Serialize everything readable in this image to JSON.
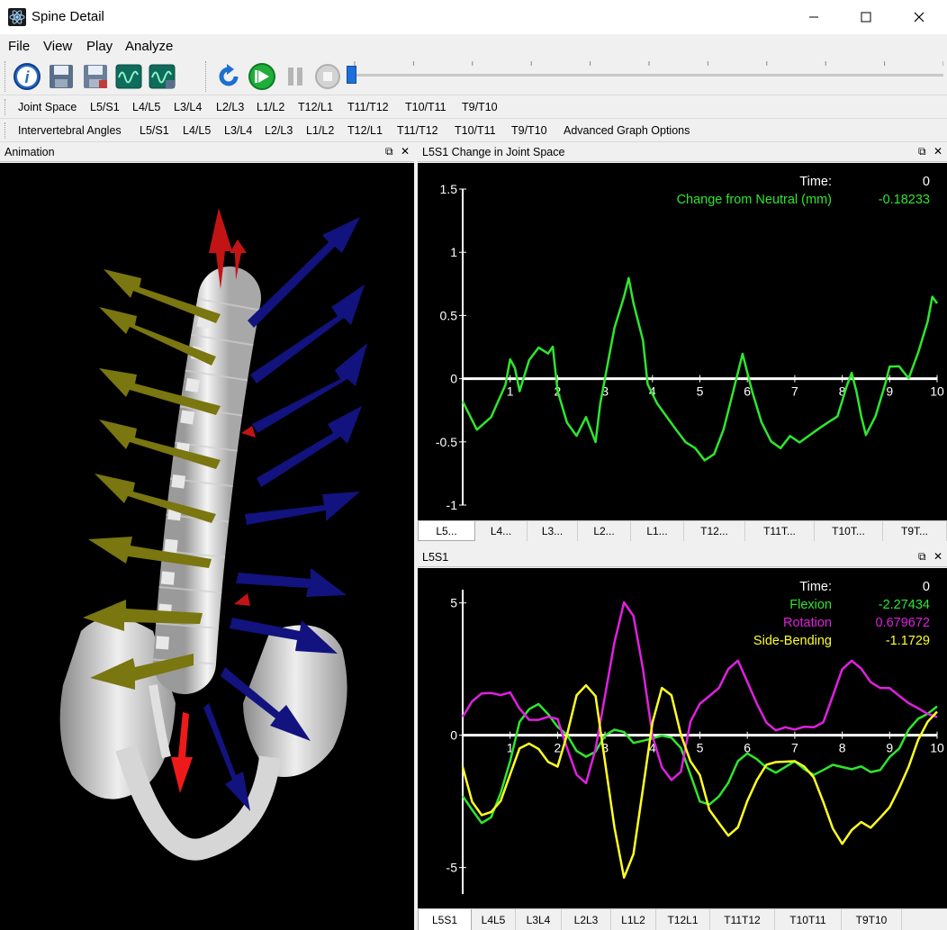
{
  "window": {
    "title": "Spine Detail"
  },
  "menu": [
    "File",
    "View",
    "Play",
    "Analyze"
  ],
  "toolbar": {
    "buttons": [
      "info-icon",
      "save-icon",
      "save-as-icon",
      "graph-icon",
      "graph-settings-icon",
      "rewind-icon",
      "play-icon",
      "pause-icon",
      "stop-icon"
    ],
    "playback_position": 0
  },
  "nav_joint_space": [
    "Joint Space",
    "L5/S1",
    "L4/L5",
    "L3/L4",
    "L2/L3",
    "L1/L2",
    "T12/L1",
    "T11/T12",
    "T10/T11",
    "T9/T10"
  ],
  "nav_angles": [
    "Intervertebral Angles",
    "L5/S1",
    "L4/L5",
    "L3/L4",
    "L2/L3",
    "L1/L2",
    "T12/L1",
    "T11/T12",
    "T10/T11",
    "T9/T10",
    "Advanced Graph Options"
  ],
  "panels": {
    "animation": {
      "title": "Animation"
    },
    "joint_space": {
      "title": "L5S1 Change in Joint Space"
    },
    "angles": {
      "title": "L5S1"
    }
  },
  "joint_tabs": [
    "L5...",
    "L4...",
    "L3...",
    "L2...",
    "L1...",
    "T12...",
    "T11T...",
    "T10T...",
    "T9T..."
  ],
  "angle_tabs": [
    "L5S1",
    "L4L5",
    "L3L4",
    "L2L3",
    "L1L2",
    "T12L1",
    "T11T12",
    "T10T11",
    "T9T10"
  ],
  "colors": {
    "green": "#2ee62e",
    "magenta": "#e020e0",
    "yellow": "#ffff22",
    "axis": "#ffffff"
  },
  "chart_data": [
    {
      "type": "line",
      "title": "",
      "xlim": [
        0,
        10
      ],
      "ylim": [
        -1,
        1.5
      ],
      "x_ticks": [
        1,
        2,
        3,
        4,
        5,
        6,
        7,
        8,
        9,
        10
      ],
      "y_ticks": [
        -1,
        -0.5,
        0,
        0.5,
        1,
        1.5
      ],
      "readout": [
        {
          "label": "Time:",
          "value": "0",
          "color": "#ffffff"
        },
        {
          "label": "Change from Neutral (mm)",
          "value": "-0.18233",
          "color": "#2ee62e"
        }
      ],
      "series": [
        {
          "color": "#2ee62e",
          "x": [
            0,
            0.3,
            0.6,
            0.9,
            1.0,
            1.1,
            1.2,
            1.4,
            1.6,
            1.8,
            1.9,
            2.0,
            2.2,
            2.4,
            2.6,
            2.8,
            2.9,
            3.0,
            3.2,
            3.4,
            3.5,
            3.6,
            3.8,
            3.9,
            4.1,
            4.3,
            4.5,
            4.7,
            4.9,
            5.1,
            5.3,
            5.5,
            5.7,
            5.9,
            6.1,
            6.3,
            6.5,
            6.7,
            6.9,
            7.1,
            7.3,
            7.5,
            7.7,
            7.9,
            8.1,
            8.2,
            8.3,
            8.4,
            8.5,
            8.7,
            8.9,
            9.0,
            9.2,
            9.4,
            9.6,
            9.8,
            9.9,
            10.0
          ],
          "values": [
            -0.18,
            -0.4,
            -0.3,
            -0.05,
            0.15,
            0.08,
            -0.1,
            0.15,
            0.25,
            0.2,
            0.25,
            -0.1,
            -0.35,
            -0.45,
            -0.3,
            -0.5,
            -0.2,
            0.0,
            0.4,
            0.65,
            0.8,
            0.6,
            0.3,
            -0.05,
            -0.2,
            -0.3,
            -0.4,
            -0.5,
            -0.55,
            -0.65,
            -0.6,
            -0.4,
            -0.1,
            0.2,
            -0.1,
            -0.35,
            -0.5,
            -0.55,
            -0.45,
            -0.5,
            -0.45,
            -0.4,
            -0.35,
            -0.3,
            -0.05,
            0.05,
            -0.1,
            -0.3,
            -0.45,
            -0.3,
            -0.05,
            0.1,
            0.1,
            0.0,
            0.2,
            0.45,
            0.65,
            0.6
          ]
        }
      ]
    },
    {
      "type": "line",
      "title": "",
      "xlim": [
        0,
        10
      ],
      "ylim": [
        -6,
        5.5
      ],
      "x_ticks": [
        1,
        2,
        3,
        4,
        5,
        6,
        7,
        8,
        9,
        10
      ],
      "y_ticks": [
        -5,
        0,
        5
      ],
      "readout": [
        {
          "label": "Time:",
          "value": "0",
          "color": "#ffffff"
        },
        {
          "label": "Flexion",
          "value": "-2.27434",
          "color": "#2ee62e"
        },
        {
          "label": "Rotation",
          "value": "0.679672",
          "color": "#e020e0"
        },
        {
          "label": "Side-Bending",
          "value": "-1.1729",
          "color": "#ffff22"
        }
      ],
      "series": [
        {
          "name": "Flexion",
          "color": "#2ee62e",
          "x": [
            0,
            0.2,
            0.4,
            0.6,
            0.8,
            1.0,
            1.2,
            1.4,
            1.6,
            1.8,
            2.0,
            2.2,
            2.4,
            2.6,
            2.8,
            3.0,
            3.2,
            3.4,
            3.6,
            3.8,
            4.0,
            4.2,
            4.4,
            4.6,
            4.8,
            5.0,
            5.2,
            5.4,
            5.6,
            5.8,
            6.0,
            6.2,
            6.4,
            6.6,
            6.8,
            7.0,
            7.2,
            7.4,
            7.6,
            7.8,
            8.0,
            8.2,
            8.4,
            8.6,
            8.8,
            9.0,
            9.2,
            9.4,
            9.6,
            9.8,
            10.0
          ],
          "values": [
            -2.3,
            -2.8,
            -3.3,
            -3.1,
            -2.2,
            -1.0,
            0.5,
            1.0,
            1.2,
            0.8,
            0.3,
            0.0,
            -0.6,
            -0.8,
            -0.6,
            0.0,
            0.2,
            0.1,
            -0.3,
            -0.2,
            -0.1,
            0.0,
            -0.1,
            -0.5,
            -1.5,
            -2.5,
            -2.6,
            -2.3,
            -1.8,
            -1.0,
            -0.7,
            -0.9,
            -1.2,
            -1.4,
            -1.2,
            -1.0,
            -1.3,
            -1.5,
            -1.3,
            -1.1,
            -1.2,
            -1.3,
            -1.2,
            -1.4,
            -1.3,
            -0.8,
            -0.5,
            0.2,
            0.6,
            0.8,
            1.1
          ]
        },
        {
          "name": "Rotation",
          "color": "#e020e0",
          "x": [
            0,
            0.2,
            0.4,
            0.6,
            0.8,
            1.0,
            1.2,
            1.4,
            1.6,
            1.8,
            2.0,
            2.2,
            2.4,
            2.6,
            2.8,
            3.0,
            3.2,
            3.4,
            3.6,
            3.8,
            4.0,
            4.2,
            4.4,
            4.6,
            4.8,
            5.0,
            5.2,
            5.4,
            5.6,
            5.8,
            6.0,
            6.2,
            6.4,
            6.6,
            6.8,
            7.0,
            7.2,
            7.4,
            7.6,
            7.8,
            8.0,
            8.2,
            8.4,
            8.6,
            8.8,
            9.0,
            9.2,
            9.4,
            9.6,
            9.8,
            10.0
          ],
          "values": [
            0.7,
            1.3,
            1.6,
            1.6,
            1.5,
            1.6,
            1.0,
            0.6,
            0.6,
            0.7,
            0.6,
            -0.5,
            -1.5,
            -1.8,
            -0.5,
            1.5,
            3.5,
            5.0,
            4.5,
            2.5,
            0.0,
            -1.2,
            -1.7,
            -1.4,
            0.5,
            1.2,
            1.5,
            1.8,
            2.5,
            2.8,
            2.0,
            1.2,
            0.5,
            0.2,
            0.3,
            0.2,
            0.3,
            0.3,
            0.5,
            1.5,
            2.5,
            2.8,
            2.5,
            2.0,
            1.8,
            1.8,
            1.5,
            1.2,
            1.0,
            0.8,
            0.7
          ]
        },
        {
          "name": "Side-Bending",
          "color": "#ffff22",
          "x": [
            0,
            0.2,
            0.4,
            0.6,
            0.8,
            1.0,
            1.2,
            1.4,
            1.6,
            1.8,
            2.0,
            2.2,
            2.4,
            2.6,
            2.8,
            3.0,
            3.2,
            3.4,
            3.6,
            3.8,
            4.0,
            4.2,
            4.4,
            4.6,
            4.8,
            5.0,
            5.2,
            5.4,
            5.6,
            5.8,
            6.0,
            6.2,
            6.4,
            6.6,
            6.8,
            7.0,
            7.2,
            7.4,
            7.6,
            7.8,
            8.0,
            8.2,
            8.4,
            8.6,
            8.8,
            9.0,
            9.2,
            9.4,
            9.6,
            9.8,
            10.0
          ],
          "values": [
            -1.2,
            -2.5,
            -3.0,
            -2.9,
            -2.5,
            -1.5,
            -0.5,
            -0.3,
            -0.5,
            -1.0,
            -1.2,
            0.0,
            1.5,
            1.9,
            1.5,
            -1.0,
            -3.5,
            -5.4,
            -4.5,
            -2.0,
            0.5,
            1.8,
            1.5,
            0.0,
            -1.0,
            -1.5,
            -2.8,
            -3.3,
            -3.8,
            -3.5,
            -2.5,
            -1.7,
            -1.1,
            -1.0,
            -1.0,
            -1.0,
            -1.2,
            -1.6,
            -2.5,
            -3.5,
            -4.1,
            -3.6,
            -3.3,
            -3.5,
            -3.1,
            -2.7,
            -2.0,
            -1.2,
            -0.2,
            0.5,
            0.9
          ]
        }
      ]
    }
  ]
}
